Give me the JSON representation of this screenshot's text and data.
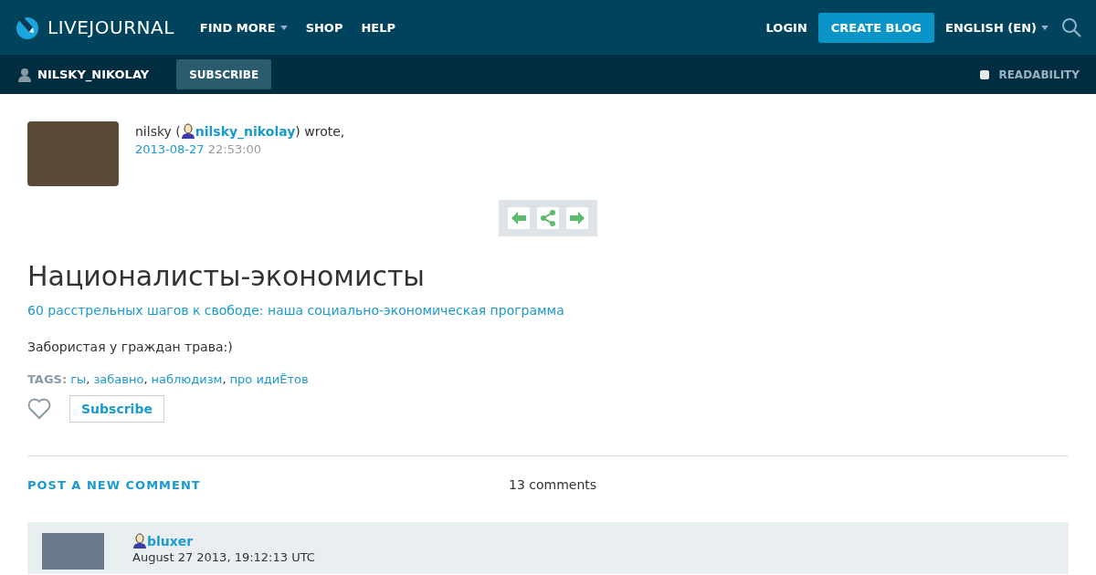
{
  "header": {
    "logo": "LIVEJOURNAL",
    "nav": [
      {
        "label": "FIND MORE",
        "dropdown": true
      },
      {
        "label": "SHOP",
        "dropdown": false
      },
      {
        "label": "HELP",
        "dropdown": false
      }
    ],
    "login": "LOGIN",
    "create_blog": "CREATE BLOG",
    "language": "ENGLISH (EN)"
  },
  "subbar": {
    "username": "NILSKY_NIKOLAY",
    "subscribe": "SUBSCRIBE",
    "readability": {
      "label": "READABILITY",
      "checked": false
    }
  },
  "post": {
    "author_name": "nilsky (",
    "author_user": "nilsky_nikolay",
    "wrote": ") wrote,",
    "date": "2013-08-27",
    "time": "22:53:00",
    "title": "Националисты-экономисты",
    "subtitle_link": "60 расстрельных шагов к свободе: наша социально-экономическая программа",
    "body": "Забористая у граждан трава:)",
    "tags_label": "TAGS:",
    "tags": [
      "гы",
      "забавно",
      "наблюдизм",
      "про идиЁтов"
    ],
    "tag_separator": ",",
    "subscribe": "Subscribe"
  },
  "comments_bar": {
    "post_comment": "POST A NEW COMMENT",
    "count": "13 comments"
  },
  "comments": [
    {
      "user": "bluxer",
      "date": "August 27 2013, 19:12:13 UTC"
    }
  ]
}
